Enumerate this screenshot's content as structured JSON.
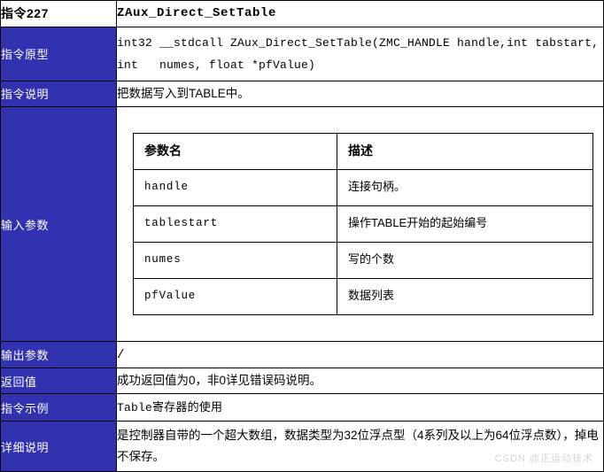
{
  "header": {
    "index_label": "指令227",
    "function_name": "ZAux_Direct_SetTable"
  },
  "rows": {
    "prototype": {
      "label": "指令原型",
      "value": "int32 __stdcall ZAux_Direct_SetTable(ZMC_HANDLE handle,int tabstart,\nint   numes, float *pfValue)"
    },
    "description": {
      "label": "指令说明",
      "value": "把数据写入到TABLE中。"
    },
    "input_params": {
      "label": "输入参数"
    },
    "output_params": {
      "label": "输出参数",
      "value": "/"
    },
    "return_value": {
      "label": "返回值",
      "value": "成功返回值为0，非0详见错误码说明。"
    },
    "example": {
      "label": "指令示例",
      "value": "Table寄存器的使用"
    },
    "detail": {
      "label": "详细说明",
      "value": "是控制器自带的一个超大数组，数据类型为32位浮点型（4系列及以上为64位浮点数），掉电不保存。"
    }
  },
  "param_table": {
    "headers": [
      "参数名",
      "描述"
    ],
    "rows": [
      {
        "name": "handle",
        "desc": "连接句柄。"
      },
      {
        "name": "tablestart",
        "desc": "操作TABLE开始的起始编号"
      },
      {
        "name": "numes",
        "desc": "写的个数"
      },
      {
        "name": "pfValue",
        "desc": "数据列表"
      }
    ]
  },
  "watermark": "CSDN @正运动技术",
  "colors": {
    "label_blue": "#3232b0",
    "border": "#000000",
    "text": "#000000",
    "watermark": "#d4d4d4"
  }
}
